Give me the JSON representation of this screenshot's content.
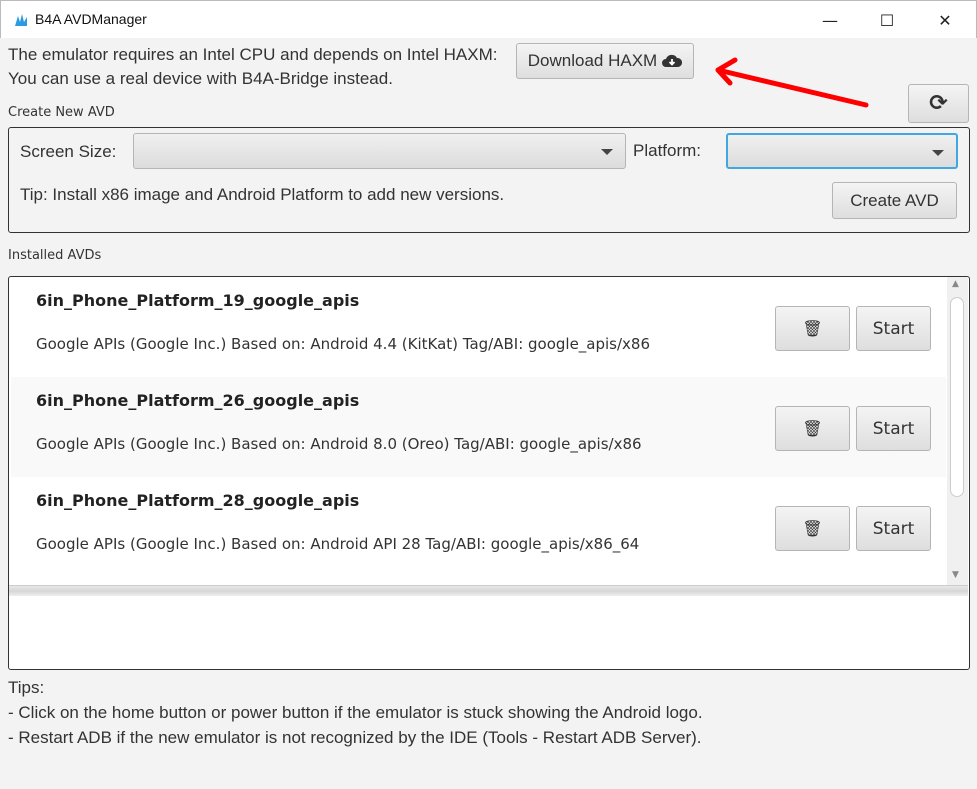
{
  "window": {
    "title": "B4A AVDManager",
    "minimize": "—",
    "maximize": "☐",
    "close": "✕"
  },
  "header": {
    "line1": "The emulator requires an Intel CPU and depends on Intel HAXM:",
    "line2": "You can use a real device with B4A-Bridge instead.",
    "download_label": "Download HAXM"
  },
  "create": {
    "section_label": "Create New AVD",
    "screen_size_label": "Screen Size:",
    "screen_size_value": "",
    "platform_label": "Platform:",
    "platform_value": "",
    "tip": "Tip: Install x86 image and Android Platform to add new versions.",
    "create_label": "Create AVD"
  },
  "installed": {
    "section_label": "Installed AVDs",
    "items": [
      {
        "name": "6in_Phone_Platform_19_google_apis",
        "desc": "Google APIs (Google Inc.) Based on: Android 4.4 (KitKat) Tag/ABI: google_apis/x86",
        "start": "Start"
      },
      {
        "name": "6in_Phone_Platform_26_google_apis",
        "desc": "Google APIs (Google Inc.) Based on: Android 8.0 (Oreo) Tag/ABI: google_apis/x86",
        "start": "Start"
      },
      {
        "name": "6in_Phone_Platform_28_google_apis",
        "desc": "Google APIs (Google Inc.) Based on: Android API 28 Tag/ABI: google_apis/x86_64",
        "start": "Start"
      }
    ]
  },
  "log": {
    "value": ""
  },
  "tips": {
    "title": "Tips:",
    "lines": [
      "- Click on the home button or power button if the emulator is stuck showing the Android logo.",
      "- Restart ADB if the new emulator is not recognized by the IDE (Tools - Restart ADB Server)."
    ]
  },
  "colors": {
    "annotation_arrow": "#ff0000",
    "focus": "#3fa8e0"
  }
}
